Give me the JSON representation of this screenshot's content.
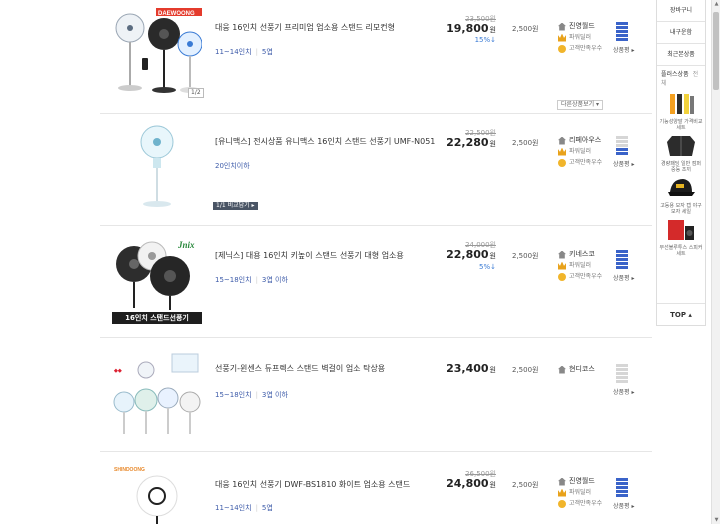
{
  "products": [
    {
      "brand_text": "DAEWOONG",
      "title": "대웅 16인치 선풍기 프리미엄 업소용 스탠드 리모컨형",
      "size": "11~14인치",
      "wings": "5엽",
      "old_price": "23,500원",
      "price": "19,800",
      "won": "원",
      "discount": "15%↓",
      "shipping": "2,500원",
      "seller": "진영월드",
      "seller_lines": [
        "파워딜러",
        "고객만족우수"
      ],
      "grade": "상품평 ▸",
      "more": "다른상품보기 ▾",
      "pager": "1/2"
    },
    {
      "title": "[유니맥스] 전시상품 유니맥스 16인치 스탠드 선풍기 UMF-N051",
      "size": "20인치이하",
      "old_price": "22,500원",
      "price": "22,280",
      "won": "원",
      "shipping": "2,500원",
      "seller": "리페아우스",
      "seller_lines": [
        "파워딜러",
        "고객만족우수"
      ],
      "grade": "상품평 ▸",
      "img_btn": "1/1 비교담기 ▸"
    },
    {
      "brand_text": "Jnix",
      "caption": "16인치 스탠드선풍기",
      "title": "[제닉스] 대용 16인치 키높이 스탠드 선풍기 대형 업소용",
      "size": "15~18인치",
      "wings": "3엽 이하",
      "old_price": "24,000원",
      "price": "22,800",
      "won": "원",
      "discount": "5%↓",
      "shipping": "2,500원",
      "seller": "키네스코",
      "seller_lines": [
        "파워딜러",
        "고객만족우수"
      ],
      "grade": "상품평 ▸"
    },
    {
      "title": "선풍기-윈센스 듀프렉스 스탠드 벽걸이 업소 탁상용",
      "size": "15~18인치",
      "wings": "3엽 이하",
      "price": "23,400",
      "won": "원",
      "shipping": "2,500원",
      "seller": "현디코스",
      "grade": "상품평 ▸"
    },
    {
      "brand_text": "SHINDOONG",
      "title": "대웅 16인치 선풍기 DWF-BS1810 화이트 업소용 스탠드",
      "size": "11~14인치",
      "wings": "5엽",
      "old_price": "26,500원",
      "price": "24,800",
      "won": "원",
      "shipping": "2,500원",
      "seller": "진영월드",
      "seller_lines": [
        "파워딜러",
        "고객만족우수"
      ],
      "grade": "상품평 ▸"
    }
  ],
  "sidebar": {
    "cart": "장바구니",
    "mypage": "내구운함",
    "recent": "최근본상품",
    "recommend": "플러스상품",
    "recommend_more": "전체",
    "items": [
      {
        "caption": "기능성양말 가격비교세트"
      },
      {
        "caption": "경량패딩 일반 점퍼 중등 조끼"
      },
      {
        "caption": "고등용 모자 캡 야구모자 세일"
      },
      {
        "caption": "무선블루투스 스피커 세트"
      }
    ],
    "top": "TOP ▴"
  },
  "colors": {
    "link_blue": "#3d5ba9",
    "bar_blue": "#3a63c9",
    "discount_blue": "#3a7bd5"
  }
}
